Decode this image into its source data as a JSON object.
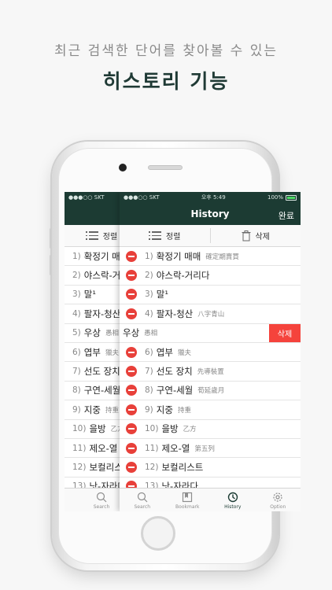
{
  "promo": {
    "subtitle": "최근 검색한 단어를 찾아볼 수 있는",
    "title": "히스토리 기능"
  },
  "status_bar": {
    "carrier": "●●●○○ SKT",
    "time": "오후 5:49",
    "battery": "100%"
  },
  "nav": {
    "title": "History",
    "done_label": "완료"
  },
  "toolbar": {
    "sort_label": "정렬",
    "delete_label": "삭제"
  },
  "history": [
    {
      "num": "1)",
      "word": "확정기 매매",
      "hanja": "確定期賣買"
    },
    {
      "num": "2)",
      "word": "야스락-거리다",
      "hanja": ""
    },
    {
      "num": "3)",
      "word": "말¹",
      "hanja": ""
    },
    {
      "num": "4)",
      "word": "팔자-청산",
      "hanja": "八字青山"
    },
    {
      "num": "5)",
      "word": "우상",
      "hanja": "愚相"
    },
    {
      "num": "6)",
      "word": "엽부",
      "hanja": "獵夫"
    },
    {
      "num": "7)",
      "word": "선도 장치",
      "hanja": "先導裝置"
    },
    {
      "num": "8)",
      "word": "구연-세월",
      "hanja": "荀延歲月"
    },
    {
      "num": "9)",
      "word": "지중",
      "hanja": "持重"
    },
    {
      "num": "10)",
      "word": "을방",
      "hanja": "乙方"
    },
    {
      "num": "11)",
      "word": "제오-열",
      "hanja": "第五列"
    },
    {
      "num": "12)",
      "word": "보컬리스트",
      "hanja": ""
    },
    {
      "num": "13)",
      "word": "낫-자라다",
      "hanja": ""
    }
  ],
  "swipe_delete_label": "삭제",
  "tabs": [
    {
      "label": "Search",
      "icon": "search-icon"
    },
    {
      "label": "Bookmark",
      "icon": "bookmark-icon"
    },
    {
      "label": "History",
      "icon": "clock-icon"
    },
    {
      "label": "Option",
      "icon": "gear-icon"
    }
  ],
  "active_tab": "History",
  "colors": {
    "nav_bg": "#1c3b33",
    "delete_red": "#f5433c",
    "minus_red": "#e8403a"
  }
}
